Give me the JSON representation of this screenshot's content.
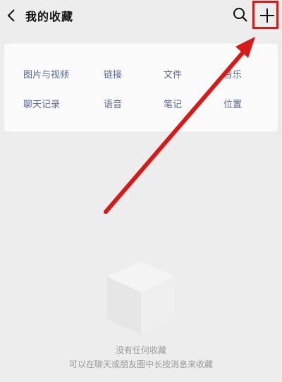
{
  "header": {
    "title": "我的收藏",
    "back_icon": "chevron-left-icon",
    "search_icon": "search-icon",
    "add_icon": "plus-icon"
  },
  "categories": [
    {
      "label": "图片与视频"
    },
    {
      "label": "链接"
    },
    {
      "label": "文件"
    },
    {
      "label": "音乐"
    },
    {
      "label": "聊天记录"
    },
    {
      "label": "语音"
    },
    {
      "label": "笔记"
    },
    {
      "label": "位置"
    }
  ],
  "empty_state": {
    "title": "没有任何收藏",
    "subtitle": "可以在聊天或朋友圈中长按消息来收藏",
    "icon": "empty-box-icon"
  },
  "annotation": {
    "color": "#d91818",
    "arrow_icon": "red-arrow-icon"
  }
}
